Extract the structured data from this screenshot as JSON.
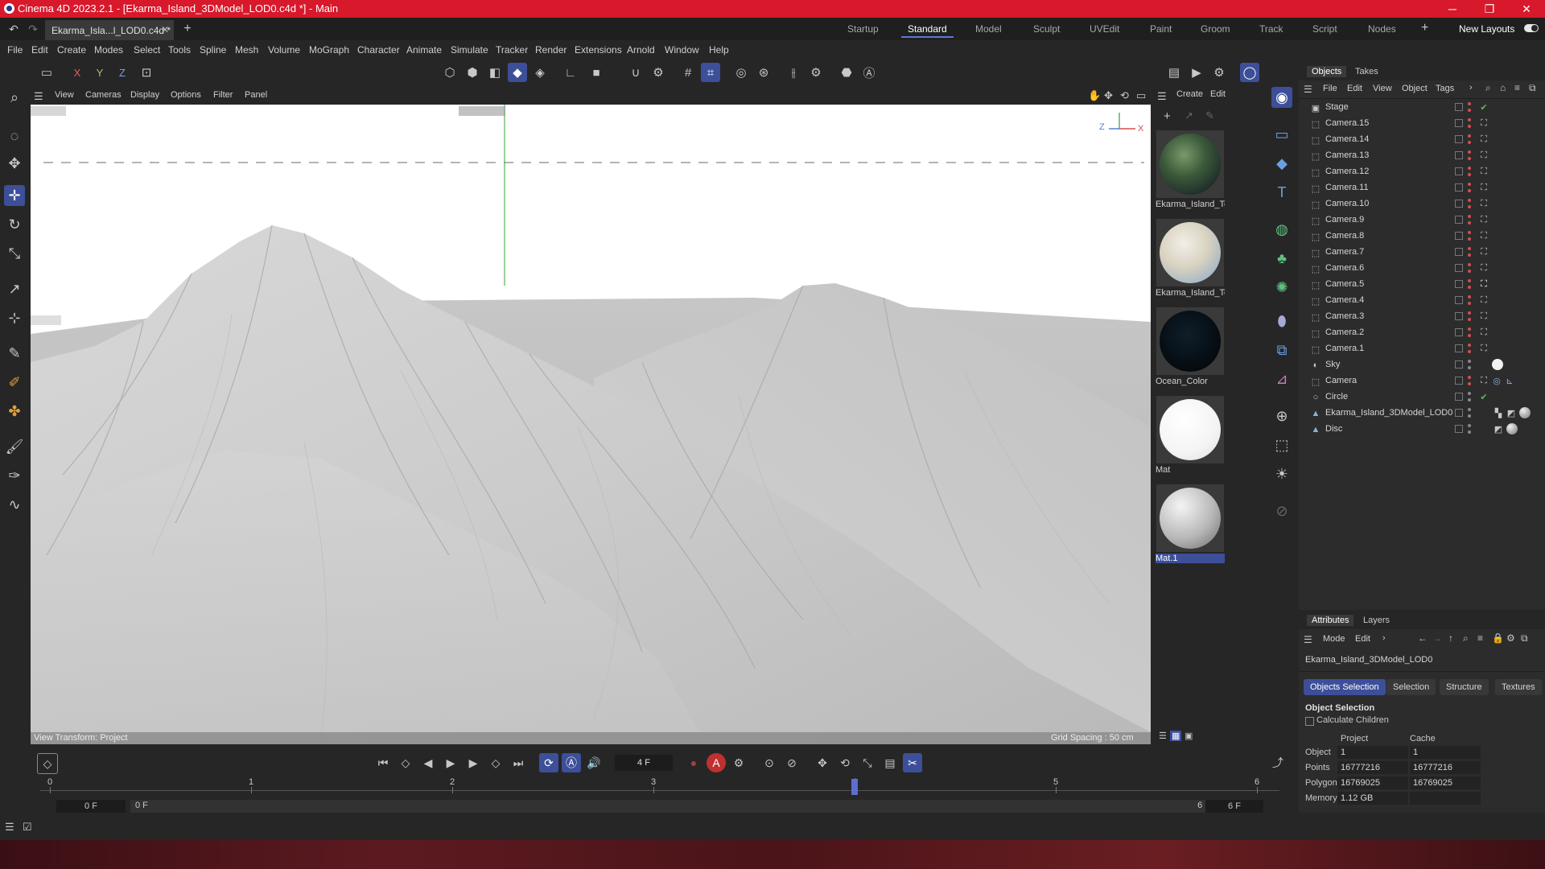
{
  "window": {
    "title": "Cinema 4D 2023.2.1 - [Ekarma_Island_3DModel_LOD0.c4d *] - Main",
    "minimize": "─",
    "restore": "❐",
    "close": "✕"
  },
  "tabs": {
    "doc_tab": "Ekarma_Isla...l_LOD0.c4d *",
    "layouts": [
      "Startup",
      "Standard",
      "Model",
      "Sculpt",
      "UVEdit",
      "Paint",
      "Groom",
      "Track",
      "Script",
      "Nodes"
    ],
    "new_layouts": "New Layouts"
  },
  "menu": [
    "File",
    "Edit",
    "Create",
    "Modes",
    "Select",
    "Tools",
    "Spline",
    "Mesh",
    "Volume",
    "MoGraph",
    "Character",
    "Animate",
    "Simulate",
    "Tracker",
    "Render",
    "Extensions",
    "Arnold",
    "Window",
    "Help"
  ],
  "toolbar": {
    "axis_x": "X",
    "axis_y": "Y",
    "axis_z": "Z"
  },
  "viewport": {
    "menu": [
      "View",
      "Cameras",
      "Display",
      "Options",
      "Filter",
      "Panel"
    ],
    "view_transform": "View Transform: Project",
    "grid_spacing": "Grid Spacing : 50 cm",
    "axis_z": "Z",
    "axis_x": "X"
  },
  "materials": {
    "menu": [
      "Create",
      "Edit"
    ],
    "items": [
      {
        "name": "Ekarma_Island_Te"
      },
      {
        "name": "Ekarma_Island_Te"
      },
      {
        "name": "Ocean_Color"
      },
      {
        "name": "Mat"
      },
      {
        "name": "Mat.1"
      }
    ]
  },
  "objects_panel": {
    "tabs": [
      "Objects",
      "Takes"
    ],
    "menu": [
      "File",
      "Edit",
      "View",
      "Object",
      "Tags"
    ],
    "items": [
      {
        "name": "Stage"
      },
      {
        "name": "Camera.15"
      },
      {
        "name": "Camera.14"
      },
      {
        "name": "Camera.13"
      },
      {
        "name": "Camera.12"
      },
      {
        "name": "Camera.11"
      },
      {
        "name": "Camera.10"
      },
      {
        "name": "Camera.9"
      },
      {
        "name": "Camera.8"
      },
      {
        "name": "Camera.7"
      },
      {
        "name": "Camera.6"
      },
      {
        "name": "Camera.5"
      },
      {
        "name": "Camera.4"
      },
      {
        "name": "Camera.3"
      },
      {
        "name": "Camera.2"
      },
      {
        "name": "Camera.1"
      },
      {
        "name": "Sky"
      },
      {
        "name": "Camera"
      },
      {
        "name": "Circle"
      },
      {
        "name": "Ekarma_Island_3DModel_LOD0"
      },
      {
        "name": "Disc"
      }
    ]
  },
  "attributes": {
    "tabs": [
      "Attributes",
      "Layers"
    ],
    "menu": [
      "Mode",
      "Edit"
    ],
    "object_name": "Ekarma_Island_3DModel_LOD0",
    "sub_tabs": [
      "Objects Selection",
      "Selection",
      "Structure",
      "Textures"
    ],
    "section": "Object Selection",
    "calc_children": "Calculate Children",
    "col_project": "Project",
    "col_cache": "Cache",
    "rows": [
      {
        "label": "Object",
        "project": "1",
        "cache": "1"
      },
      {
        "label": "Points",
        "project": "16777216",
        "cache": "16777216"
      },
      {
        "label": "Polygons",
        "project": "16769025",
        "cache": "16769025"
      },
      {
        "label": "Memory",
        "project": "1.12 GB",
        "cache": ""
      }
    ]
  },
  "timeline": {
    "current_frame": "4 F",
    "start_field": "0 F",
    "start_range": "0 F",
    "end_range": "6 F",
    "end_field": "6 F",
    "ticks": [
      "0",
      "1",
      "2",
      "3",
      "4",
      "5",
      "6"
    ],
    "playhead": 4,
    "frame_max": 6
  },
  "colors": {
    "accent": "#3d4f99",
    "titlebar": "#d8182b"
  }
}
